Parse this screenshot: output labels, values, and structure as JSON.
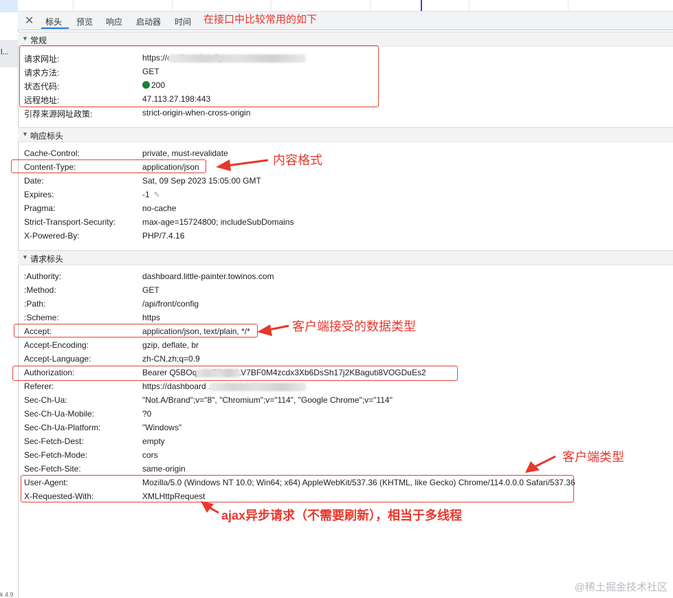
{
  "left_panel": {
    "truncated_item": "l...",
    "footer_text": "k 4.9"
  },
  "tabs": {
    "close_label": "✕",
    "items": [
      {
        "label": "标头",
        "active": true
      },
      {
        "label": "预览",
        "active": false
      },
      {
        "label": "响应",
        "active": false
      },
      {
        "label": "启动器",
        "active": false
      },
      {
        "label": "时间",
        "active": false
      }
    ]
  },
  "annotations": {
    "top_note": "在接口中比较常用的如下",
    "content_format": "内容格式",
    "accept_types": "客户端接受的数据类型",
    "client_type": "客户端类型",
    "ajax": "ajax异步请求（不需要刷新），相当于多线程"
  },
  "general": {
    "title": "常规",
    "rows": [
      {
        "key": "请求网址:",
        "value": "https://c                                  pi/front/config"
      },
      {
        "key": "请求方法:",
        "value": "GET"
      },
      {
        "key": "状态代码:",
        "value": "200"
      },
      {
        "key": "远程地址:",
        "value": "47.113.27.198:443"
      },
      {
        "key": "引荐来源网址政策:",
        "value": "strict-origin-when-cross-origin"
      }
    ]
  },
  "response_headers": {
    "title": "响应标头",
    "rows": [
      {
        "key": "Cache-Control:",
        "value": "private, must-revalidate"
      },
      {
        "key": "Content-Type:",
        "value": "application/json"
      },
      {
        "key": "Date:",
        "value": "Sat, 09 Sep 2023 15:05:00 GMT"
      },
      {
        "key": "Expires:",
        "value": "-1"
      },
      {
        "key": "Pragma:",
        "value": "no-cache"
      },
      {
        "key": "Strict-Transport-Security:",
        "value": "max-age=15724800; includeSubDomains"
      },
      {
        "key": "X-Powered-By:",
        "value": "PHP/7.4.16"
      }
    ]
  },
  "request_headers": {
    "title": "请求标头",
    "rows": [
      {
        "key": ":Authority:",
        "value": "dashboard.little-painter.towinos.com"
      },
      {
        "key": ":Method:",
        "value": "GET"
      },
      {
        "key": ":Path:",
        "value": "/api/front/config"
      },
      {
        "key": ":Scheme:",
        "value": "https"
      },
      {
        "key": "Accept:",
        "value": "application/json, text/plain, */*"
      },
      {
        "key": "Accept-Encoding:",
        "value": "gzip, deflate, br"
      },
      {
        "key": "Accept-Language:",
        "value": "zh-CN,zh;q=0.9"
      },
      {
        "key": "Authorization:",
        "value": "Bearer Q5BOqp                   lmTPKIULV7BF0M4zcdx3Xb6DsSh17j2KBaguti8VOGDuEs2"
      },
      {
        "key": "Referer:",
        "value": "https://dashboard                        .com/match-list"
      },
      {
        "key": "Sec-Ch-Ua:",
        "value": "\"Not.A/Brand\";v=\"8\", \"Chromium\";v=\"114\", \"Google Chrome\";v=\"114\""
      },
      {
        "key": "Sec-Ch-Ua-Mobile:",
        "value": "?0"
      },
      {
        "key": "Sec-Ch-Ua-Platform:",
        "value": "\"Windows\""
      },
      {
        "key": "Sec-Fetch-Dest:",
        "value": "empty"
      },
      {
        "key": "Sec-Fetch-Mode:",
        "value": "cors"
      },
      {
        "key": "Sec-Fetch-Site:",
        "value": "same-origin"
      },
      {
        "key": "User-Agent:",
        "value": "Mozilla/5.0 (Windows NT 10.0; Win64; x64) AppleWebKit/537.36 (KHTML, like Gecko) Chrome/114.0.0.0 Safari/537.36"
      },
      {
        "key": "X-Requested-With:",
        "value": "XMLHttpRequest"
      }
    ]
  },
  "watermark": "@稀土掘金技术社区",
  "colors": {
    "annotation_red": "#e8372c",
    "status_green": "#188038",
    "tab_accent": "#1a73e8"
  }
}
